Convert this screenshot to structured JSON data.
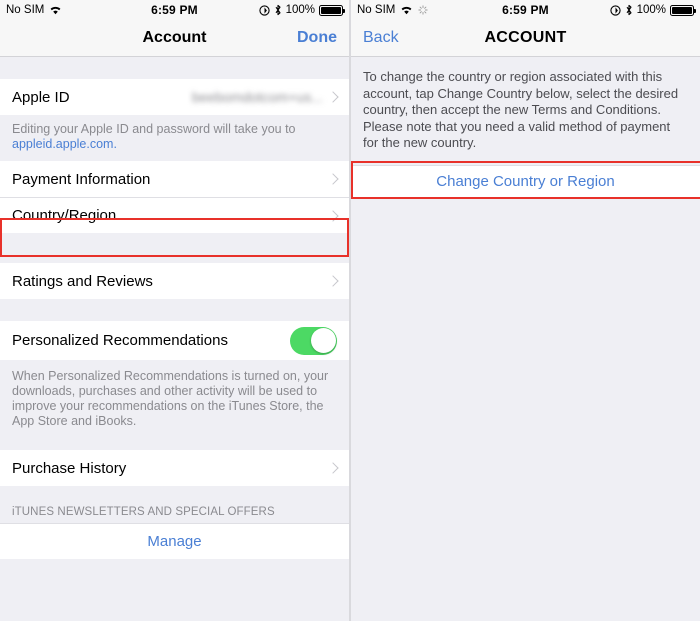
{
  "left": {
    "status": {
      "carrier": "No SIM",
      "time": "6:59 PM",
      "battery_percent": "100%",
      "icons": [
        "wifi-icon",
        "location-icon",
        "bluetooth-icon",
        "battery-icon"
      ]
    },
    "nav": {
      "title": "Account",
      "right_button": "Done"
    },
    "apple_id": {
      "label": "Apple ID",
      "value": "beebomdotcom+us...",
      "footer_text": "Editing your Apple ID and password will take you to ",
      "footer_link": "appleid.apple.com."
    },
    "rows": [
      {
        "label": "Payment Information"
      },
      {
        "label": "Country/Region"
      }
    ],
    "ratings_row": {
      "label": "Ratings and Reviews"
    },
    "personalized": {
      "label": "Personalized Recommendations",
      "toggle_state": "on",
      "footer": "When Personalized Recommendations is turned on, your downloads, purchases and other activity will be used to improve your recommendations on the iTunes Store, the App Store and iBooks."
    },
    "purchase_row": {
      "label": "Purchase History"
    },
    "newsletters": {
      "header": "iTUNES NEWSLETTERS AND SPECIAL OFFERS",
      "link": "Manage"
    }
  },
  "right": {
    "status": {
      "carrier": "No SIM",
      "time": "6:59 PM",
      "battery_percent": "100%",
      "icons": [
        "wifi-icon",
        "activity-spinner-icon",
        "location-icon",
        "bluetooth-icon",
        "battery-icon"
      ]
    },
    "nav": {
      "left_button": "Back",
      "title": "ACCOUNT"
    },
    "body_text": "To change the country or region associated with this account, tap Change Country below, select the desired country, then accept the new Terms and Conditions. Please note that you need a valid method of payment for the new country.",
    "change_button": "Change Country or Region"
  },
  "colors": {
    "highlight": "#e8312a",
    "link": "#4a7fd4",
    "toggle_on": "#4cd964",
    "group_bg": "#efeff4"
  }
}
